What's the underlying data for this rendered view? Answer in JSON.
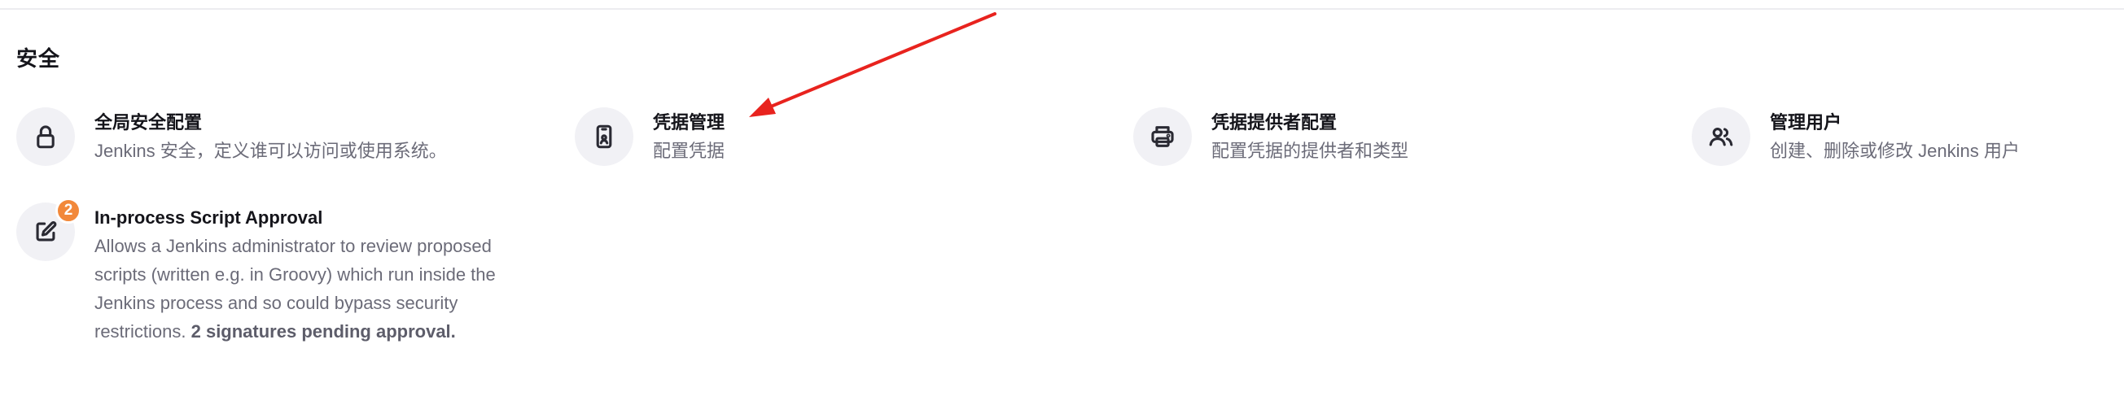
{
  "section": {
    "title": "安全"
  },
  "items": [
    {
      "title": "全局安全配置",
      "description": "Jenkins 安全，定义谁可以访问或使用系统。",
      "icon": "lock-icon"
    },
    {
      "title": "凭据管理",
      "description": "配置凭据",
      "icon": "phone-id-icon"
    },
    {
      "title": "凭据提供者配置",
      "description": "配置凭据的提供者和类型",
      "icon": "printer-icon"
    },
    {
      "title": "管理用户",
      "description": "创建、删除或修改 Jenkins 用户",
      "icon": "users-icon"
    },
    {
      "title": "In-process Script Approval",
      "description": "Allows a Jenkins administrator to review proposed scripts (written e.g. in Groovy) which run inside the Jenkins process and so could bypass security restrictions.",
      "pending": "2 signatures pending approval.",
      "badge": "2",
      "icon": "edit-square-icon"
    }
  ],
  "colors": {
    "badge": "#f2883a",
    "annotation_arrow": "#e8231e",
    "icon_background": "#f1f1f5",
    "description_text": "#6b6b78"
  }
}
